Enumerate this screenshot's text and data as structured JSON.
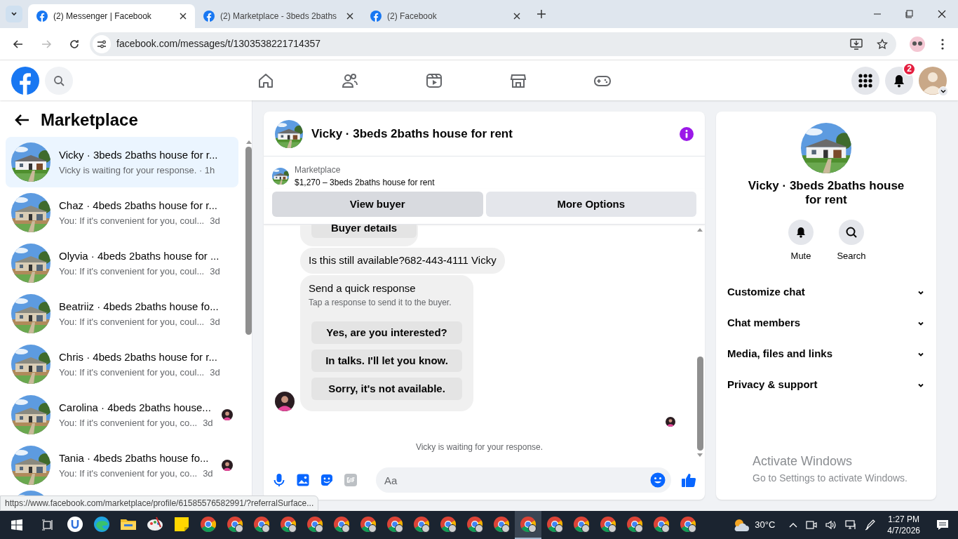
{
  "browser": {
    "tabs": [
      {
        "title": "(2) Messenger | Facebook",
        "selected": true
      },
      {
        "title": "(2) Marketplace - 3beds 2baths",
        "selected": false
      },
      {
        "title": "(2) Facebook",
        "selected": false
      }
    ],
    "url": "facebook.com/messages/t/1303538221714357"
  },
  "facebook_nav": {
    "items": [
      {
        "kind": "home",
        "selected": false
      },
      {
        "kind": "friends",
        "selected": false
      },
      {
        "kind": "video",
        "selected": false
      },
      {
        "kind": "marketplace",
        "selected": false
      },
      {
        "kind": "gaming",
        "selected": false
      }
    ],
    "notification_count": "2"
  },
  "inbox": {
    "title": "Marketplace",
    "threads": [
      {
        "name": "Vicky · 3beds 2baths house for r...",
        "preview": "Vicky is waiting for your response. · 1h",
        "selected": true,
        "seen_avatar": false
      },
      {
        "name": "Chaz · 4beds 2baths house for r...",
        "preview": "You: If it's convenient for you, coul...",
        "time": "3d",
        "selected": false,
        "seen_avatar": false
      },
      {
        "name": "Olyvia · 4beds 2baths house for ...",
        "preview": "You: If it's convenient for you, coul...",
        "time": "3d",
        "selected": false,
        "seen_avatar": false
      },
      {
        "name": "Beatriiz · 4beds 2baths house fo...",
        "preview": "You: If it's convenient for you, coul...",
        "time": "3d",
        "selected": false,
        "seen_avatar": false
      },
      {
        "name": "Chris · 4beds 2baths house for r...",
        "preview": "You: If it's convenient for you, coul...",
        "time": "3d",
        "selected": false,
        "seen_avatar": false
      },
      {
        "name": "Carolina · 4beds 2baths house...",
        "preview": "You: If it's convenient for you, co...",
        "time": "3d",
        "selected": false,
        "seen_avatar": true
      },
      {
        "name": "Tania · 4beds 2baths house fo...",
        "preview": "You: If it's convenient for you, co...",
        "time": "3d",
        "selected": false,
        "seen_avatar": true
      }
    ]
  },
  "chat": {
    "title": "Vicky · 3beds 2baths house for rent",
    "listing": {
      "label": "Marketplace",
      "text": "$1,270 – 3beds 2baths house for rent"
    },
    "buttons": [
      {
        "label": "View buyer",
        "selected": true
      },
      {
        "label": "More Options",
        "selected": false
      }
    ],
    "messages": [
      {
        "kind": "card_tail",
        "button": "Buyer details"
      },
      {
        "kind": "text",
        "text": "Is this still available?682-443-4111 Vicky"
      },
      {
        "kind": "quick_response",
        "title": "Send a quick response",
        "subtitle": "Tap a response to send it to the buyer.",
        "options": [
          "Yes, are you interested?",
          "In talks. I'll let you know.",
          "Sorry, it's not available."
        ]
      }
    ],
    "status": "Vicky is waiting for your response.",
    "composer": {
      "placeholder": "Aa"
    }
  },
  "details": {
    "title": "Vicky · 3beds 2baths house for rent",
    "actions": [
      {
        "kind": "bell",
        "label": "Mute"
      },
      {
        "kind": "search",
        "label": "Search"
      }
    ],
    "sections": [
      {
        "label": "Customize chat",
        "expanded": false
      },
      {
        "label": "Chat members",
        "expanded": false
      },
      {
        "label": "Media, files and links",
        "expanded": false
      },
      {
        "label": "Privacy & support",
        "expanded": false
      }
    ]
  },
  "link_preview": "https://www.facebook.com/marketplace/profile/61585576582991/?referralSurface...",
  "activation": {
    "title": "Activate Windows",
    "text": "Go to Settings to activate Windows."
  },
  "taskbar": {
    "apps": [
      {
        "kind": "cortana",
        "selected": false
      },
      {
        "kind": "edge",
        "selected": false
      },
      {
        "kind": "explorer",
        "selected": false
      },
      {
        "kind": "paint",
        "selected": false
      },
      {
        "kind": "sticky",
        "selected": false
      },
      {
        "kind": "chrome",
        "selected": false
      },
      {
        "kind": "chrome_profile",
        "selected": false
      },
      {
        "kind": "chrome_profile",
        "selected": false
      },
      {
        "kind": "chrome_profile",
        "selected": false
      },
      {
        "kind": "chrome_profile",
        "selected": false
      },
      {
        "kind": "chrome_profile",
        "selected": false
      },
      {
        "kind": "chrome_profile",
        "selected": false
      },
      {
        "kind": "chrome_profile",
        "selected": false
      },
      {
        "kind": "chrome_profile",
        "selected": false
      },
      {
        "kind": "chrome_profile",
        "selected": false
      },
      {
        "kind": "chrome_profile",
        "selected": false
      },
      {
        "kind": "chrome_profile",
        "selected": false
      },
      {
        "kind": "chrome_profile",
        "selected": true
      },
      {
        "kind": "chrome_profile",
        "selected": false
      },
      {
        "kind": "chrome_profile",
        "selected": false
      },
      {
        "kind": "chrome_profile",
        "selected": false
      },
      {
        "kind": "chrome_profile",
        "selected": false
      },
      {
        "kind": "chrome_profile",
        "selected": false
      },
      {
        "kind": "chrome_profile",
        "selected": false
      }
    ],
    "temperature": "30°C",
    "time": "1:27 PM",
    "date": "4/7/2026"
  }
}
